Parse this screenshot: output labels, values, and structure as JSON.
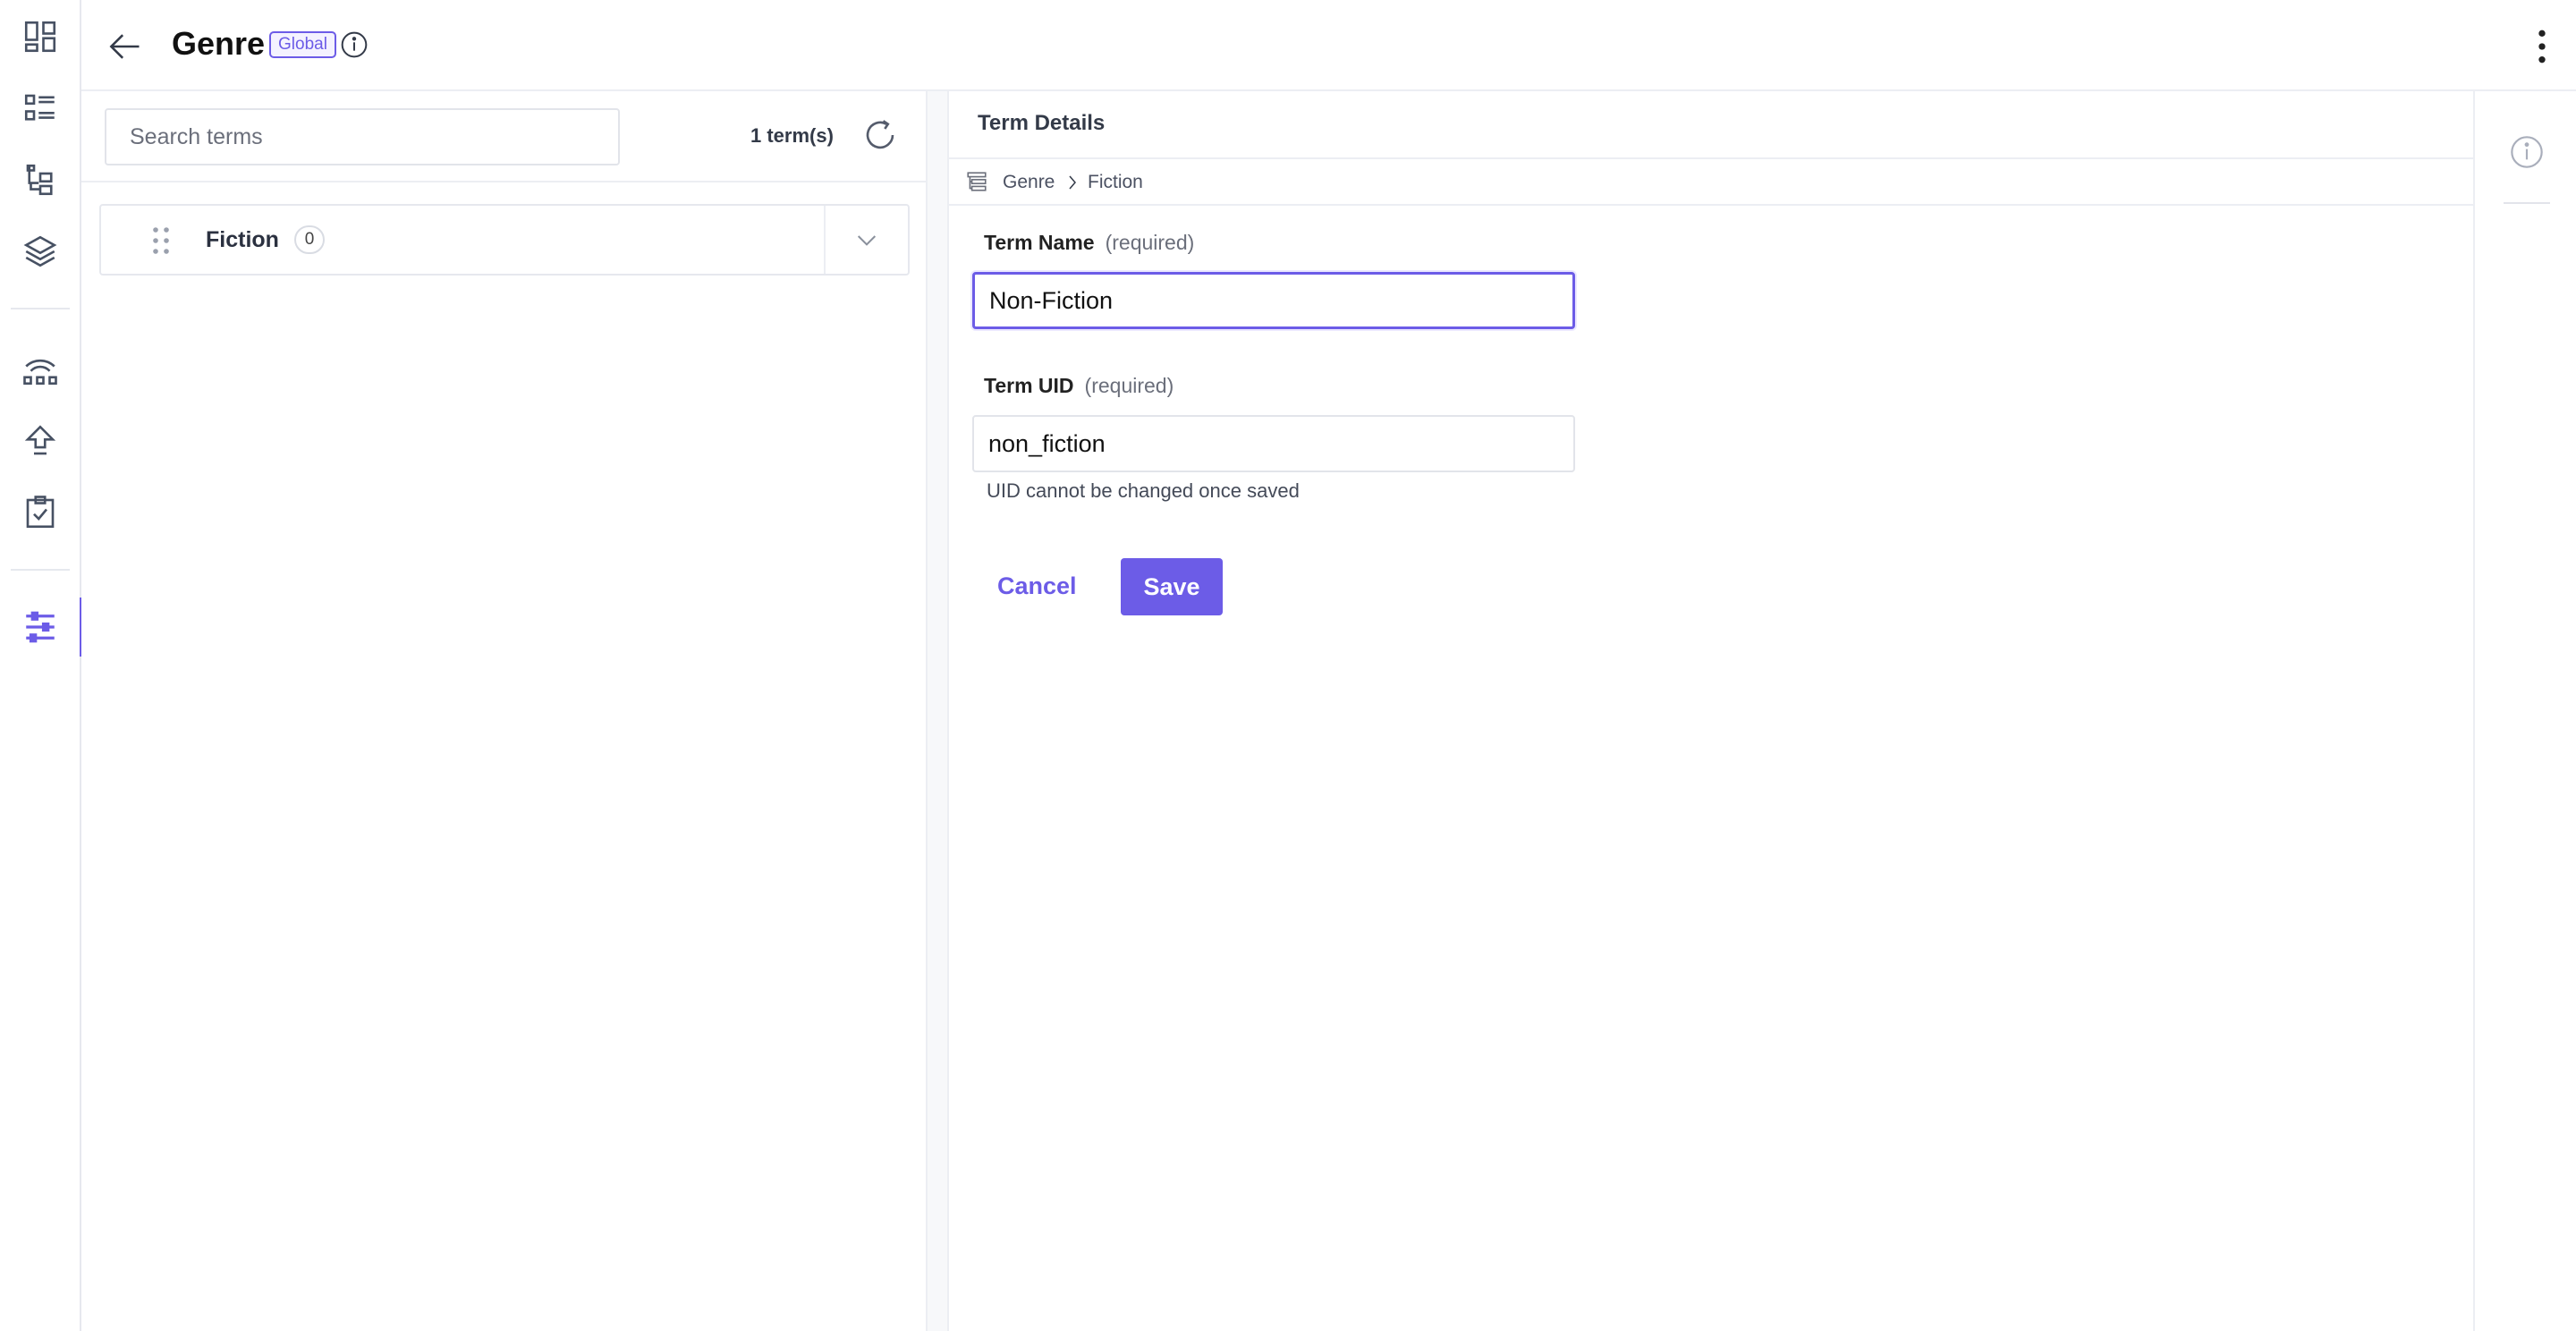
{
  "theme": {
    "accent": "#6c5ce7",
    "icon": "#475163"
  },
  "rail": {
    "items": [
      {
        "name": "dashboard-icon"
      },
      {
        "name": "entries-list-icon"
      },
      {
        "name": "content-models-icon"
      },
      {
        "name": "stack-layers-icon"
      },
      {
        "name": "releases-icon"
      },
      {
        "name": "publish-queue-icon"
      },
      {
        "name": "tasks-clipboard-icon"
      },
      {
        "name": "settings-sliders-icon",
        "active": true
      }
    ]
  },
  "header": {
    "title": "Genre",
    "badge": "Global",
    "info_icon": "info-icon",
    "menu_icon": "kebab-menu-icon"
  },
  "list": {
    "search_placeholder": "Search terms",
    "count_label": "1 term(s)",
    "terms": [
      {
        "name": "Fiction",
        "child_count": "0"
      }
    ]
  },
  "details": {
    "title": "Term Details",
    "breadcrumb": [
      "Genre",
      "Fiction"
    ],
    "term_name": {
      "label": "Term Name",
      "hint": "(required)",
      "value": "Non-Fiction"
    },
    "term_uid": {
      "label": "Term UID",
      "hint": "(required)",
      "value": "non_fiction",
      "helper": "UID cannot be changed once saved"
    },
    "cancel_label": "Cancel",
    "save_label": "Save"
  }
}
